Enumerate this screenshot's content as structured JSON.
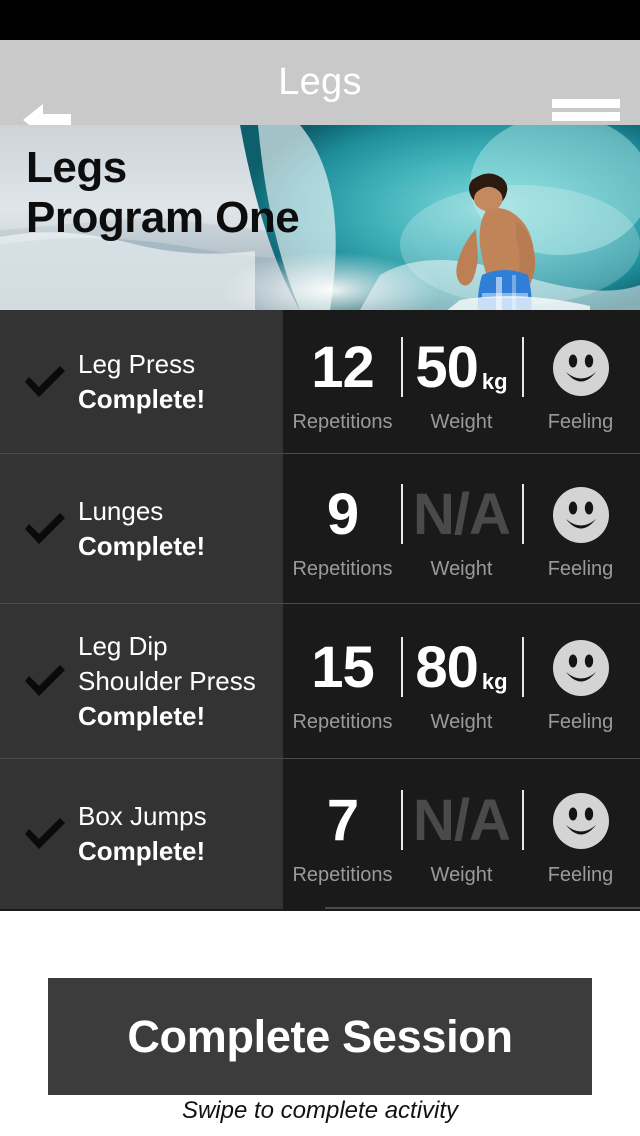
{
  "theme": {
    "status_bar_color": "#000000",
    "navbar_color": "#c9c9c9",
    "left_panel_color": "#333333",
    "right_panel_color": "#1a1a1a",
    "divider_color": "#4a4a4a",
    "cta_color": "#3c3c3c",
    "accent_text_color": "#ffffff",
    "muted_label_color": "#9a9a9a",
    "na_color": "#4a4a4a",
    "smiley_color": "#d4d4d4"
  },
  "navbar": {
    "title": "Legs",
    "back_icon": "arrow-left-icon",
    "menu_icon": "hamburger-menu-icon"
  },
  "hero": {
    "title_line1": "Legs",
    "title_line2": "Program One",
    "image_alt": "surfer-riding-wave-photo"
  },
  "table_headers": {
    "repetitions": "Repetitions",
    "weight": "Weight",
    "feeling": "Feeling"
  },
  "exercises": [
    {
      "names": [
        "Leg Press"
      ],
      "status": "Complete!",
      "check_icon": "checkmark-icon",
      "repetitions": "12",
      "weight": "50",
      "weight_unit": "kg",
      "weight_is_na": false,
      "feeling_icon": "smiley-face-icon"
    },
    {
      "names": [
        "Lunges"
      ],
      "status": "Complete!",
      "check_icon": "checkmark-icon",
      "repetitions": "9",
      "weight": "N/A",
      "weight_unit": "",
      "weight_is_na": true,
      "feeling_icon": "smiley-face-icon"
    },
    {
      "names": [
        "Leg Dip",
        "Shoulder Press"
      ],
      "status": "Complete!",
      "check_icon": "checkmark-icon",
      "repetitions": "15",
      "weight": "80",
      "weight_unit": "kg",
      "weight_is_na": false,
      "feeling_icon": "smiley-face-icon"
    },
    {
      "names": [
        "Box Jumps"
      ],
      "status": "Complete!",
      "check_icon": "checkmark-icon",
      "repetitions": "7",
      "weight": "N/A",
      "weight_unit": "",
      "weight_is_na": true,
      "feeling_icon": "smiley-face-icon"
    }
  ],
  "footer": {
    "cta_label": "Complete Session",
    "hint_label": "Swipe to complete activity"
  }
}
